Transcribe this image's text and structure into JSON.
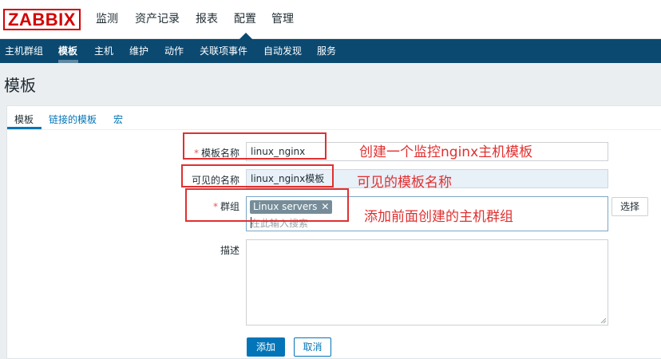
{
  "app": {
    "logo": "ZABBIX"
  },
  "top_menu": [
    {
      "label": "监测"
    },
    {
      "label": "资产记录"
    },
    {
      "label": "报表"
    },
    {
      "label": "配置"
    },
    {
      "label": "管理"
    }
  ],
  "sub_menu": [
    {
      "label": "主机群组"
    },
    {
      "label": "模板"
    },
    {
      "label": "主机"
    },
    {
      "label": "维护"
    },
    {
      "label": "动作"
    },
    {
      "label": "关联项事件"
    },
    {
      "label": "自动发现"
    },
    {
      "label": "服务"
    }
  ],
  "page": {
    "title": "模板"
  },
  "tabs": [
    {
      "label": "模板"
    },
    {
      "label": "链接的模板"
    },
    {
      "label": "宏"
    }
  ],
  "form": {
    "template_name": {
      "label": "模板名称",
      "required_mark": "*",
      "value": "linux_nginx"
    },
    "visible_name": {
      "label": "可见的名称",
      "value": "linux_nginx模板"
    },
    "groups": {
      "label": "群组",
      "required_mark": "*",
      "chip": "Linux servers",
      "chip_remove": "✕",
      "search_placeholder": "在此输入搜索",
      "select_button": "选择"
    },
    "description": {
      "label": "描述",
      "value": ""
    },
    "add_button": "添加",
    "cancel_button": "取消"
  },
  "annotations": [
    {
      "text": "创建一个监控nginx主机模板"
    },
    {
      "text": "可见的模板名称"
    },
    {
      "text": "添加前面创建的主机群组"
    }
  ],
  "colors": {
    "brand": "#d40000",
    "subnav_bg": "#0b4970",
    "link": "#0275b8",
    "annotation": "#e03030"
  }
}
